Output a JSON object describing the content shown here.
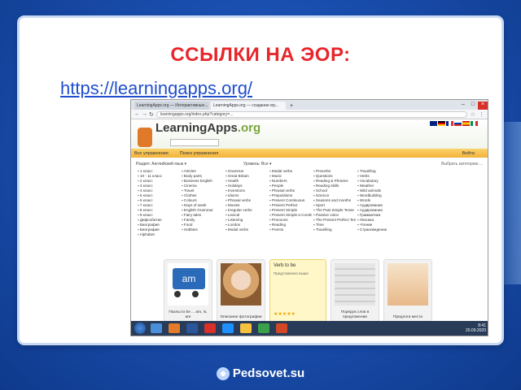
{
  "slide": {
    "title": "ССЫЛКИ НА ЭОР:",
    "link": "https://learningapps.org/"
  },
  "browser": {
    "tabs": [
      "LearningApps.org — Интерактивные...",
      "LearningApps.org — создание му..."
    ],
    "url": "learningapps.org/index.php?category=..."
  },
  "site": {
    "logo_main": "LearningApps",
    "logo_tld": ".org",
    "toolbar": [
      "Все упражнения",
      "Поиск упражнения",
      "Войти"
    ],
    "filter_left": "Раздел: Английский язык ▾",
    "filter_mid": "Уровень: Все ▾",
    "filter_right": "Выбрать категорию ...",
    "columns": [
      [
        "1 класс",
        "10 - 11 класс",
        "2 класс",
        "3 класс",
        "4 класс",
        "5 класс",
        "6 класс",
        "7 класс",
        "8 класс",
        "9 класс",
        "Дифсобитие",
        "Биография",
        "Биография",
        "Alphabet"
      ],
      [
        "Articles",
        "Body parts",
        "Business English",
        "Cinema",
        "Travel",
        "Clothes",
        "Colours",
        "Days of week",
        "English Grammar",
        "Fairy tales",
        "Family",
        "Food",
        "Hobbies"
      ],
      [
        "Grammar",
        "Great Britain",
        "Health",
        "Holidays",
        "Inventions",
        "Idioms",
        "Phrasal verbs",
        "Movies",
        "Irregular verbs",
        "Lexical",
        "Listening",
        "London",
        "Modal verbs"
      ],
      [
        "Modal verbs",
        "Music",
        "Numbers",
        "People",
        "Phrasal verbs",
        "Prepositions",
        "Present Continuous",
        "Present Perfect",
        "Present Simple",
        "Present Simple и Continuous",
        "Pronouns",
        "Reading",
        "Poems"
      ],
      [
        "Proverbs",
        "Questions",
        "Reading & Phrases",
        "Reading skills",
        "School",
        "Science",
        "Seasons and months",
        "Sport",
        "The Past Simple Tense",
        "Passive voice",
        "The Present Perfect Tense",
        "Time",
        "Travelling"
      ],
      [
        "Travelling",
        "Verbs",
        "Vocabulary",
        "Weather",
        "Wild animals",
        "Wordbuilding",
        "Words",
        "Аудирование",
        "Аудирование",
        "Грамматика",
        "Лексика",
        "Чтение",
        "Страноведение"
      ]
    ],
    "cards": [
      {
        "caption": "Пазлы to be ... am, is, are"
      },
      {
        "caption": "Описание фотографии"
      },
      {
        "title": "Verb to be",
        "sub": "Представлено выше",
        "caption": "Verb to be"
      },
      {
        "caption": "Порядок слов в предложении"
      },
      {
        "caption": "Предлоги места"
      }
    ]
  },
  "taskbar": {
    "time": "8:41",
    "date": "20.09.2020"
  },
  "footer": {
    "brand": "Pedsovet.su"
  }
}
